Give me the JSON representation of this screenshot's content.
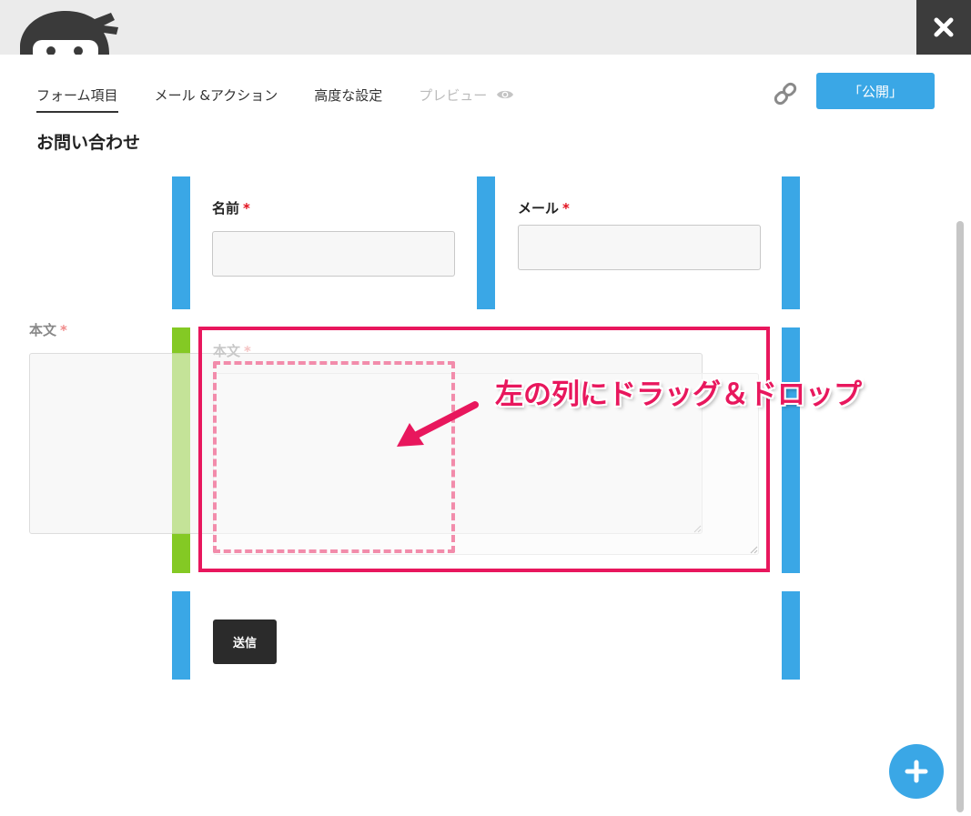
{
  "header": {
    "logo_icon": "ninja-logo-icon",
    "close_icon": "close-icon"
  },
  "tabs": [
    {
      "label": "フォーム項目",
      "state": "active"
    },
    {
      "label": "メール &アクション",
      "state": "normal"
    },
    {
      "label": "高度な設定",
      "state": "normal"
    },
    {
      "label": "プレビュー",
      "state": "disabled",
      "icon": "eye-icon"
    }
  ],
  "toolbar": {
    "link_icon": "link-icon",
    "publish_label": "「公開」"
  },
  "form": {
    "title": "お問い合わせ",
    "fields": {
      "name": {
        "label": "名前",
        "required_mark": "*",
        "value": ""
      },
      "email": {
        "label": "メール",
        "required_mark": "*",
        "value": ""
      },
      "message": {
        "label": "本文",
        "required_mark": "*",
        "value": ""
      }
    },
    "submit_label": "送信"
  },
  "annotation": {
    "text": "左の列にドラッグ＆ドロップ"
  },
  "fab": {
    "icon": "plus-icon"
  },
  "colors": {
    "accent": "#3aa7e6",
    "drop_target": "#84c924",
    "annotation": "#e8175d",
    "required": "#e2101d"
  }
}
